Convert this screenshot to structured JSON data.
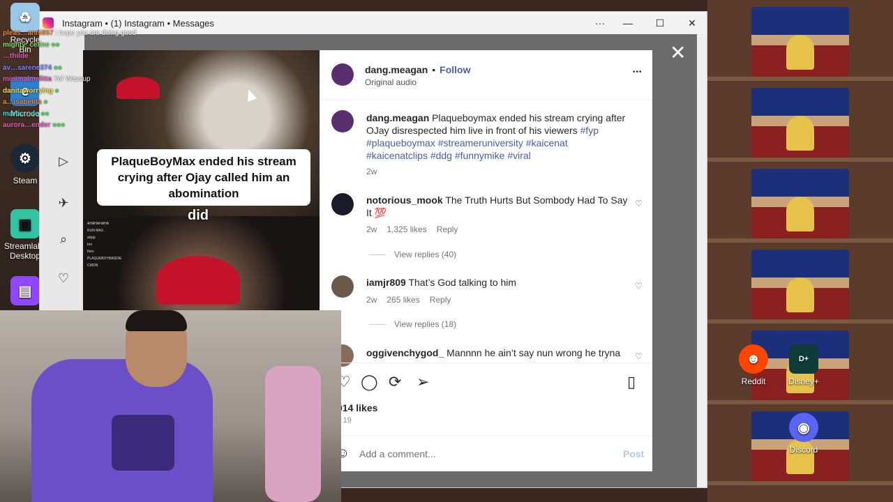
{
  "window": {
    "title": "Instagram • (1) Instagram • Messages",
    "menu_label": "···",
    "minimize": "—",
    "maximize": "☐",
    "close": "✕"
  },
  "desktop_icons": {
    "recycle": "Recycle Bin",
    "steam": "Steam",
    "streamlabs": "Streamlabs Desktop",
    "microsoft": "Microso",
    "reddit": "Reddit",
    "disney": "Disney+",
    "discord": "Discord"
  },
  "chat": [
    {
      "user": "pleas…anni857",
      "msg": "i hope you are doing good",
      "color": "#e88a3a"
    },
    {
      "user": "mighty_celine",
      "msg": "",
      "color": "#7de06a"
    },
    {
      "user": "…thilde",
      "msg": "",
      "color": "#e060b8"
    },
    {
      "user": "av…sarene374",
      "msg": "",
      "color": "#7a86ff"
    },
    {
      "user": "minimalmelitta",
      "msg": "Yo! Wassup",
      "color": "#e060b8"
    },
    {
      "user": "danitaworrying",
      "msg": "",
      "color": "#f0e040"
    },
    {
      "user": "a…isabelita",
      "msg": "",
      "color": "#e88a3a"
    },
    {
      "user": "martic…de",
      "msg": "",
      "color": "#40e0e0"
    },
    {
      "user": "aurora…ender",
      "msg": "",
      "color": "#e060b8"
    }
  ],
  "video": {
    "caption": "PlaqueBoyMax ended his stream crying after Ojay called him an abomination",
    "word": "did",
    "overlay_lines": [
      "AHAHAHAHA",
      "RUN MAX",
      "skipp",
      "bro",
      "fries",
      "PLAQUEBOYBADDIE",
      "CMON"
    ]
  },
  "post": {
    "author": "dang.meagan",
    "follow": "Follow",
    "separator": "•",
    "audio": "Original audio",
    "more": "•••",
    "caption_text": "Plaqueboymax ended his stream crying after OJay disrespected him live in front of his viewers",
    "hashtags_1": "#fyp",
    "hashtags_2": "#plaqueboymax #streameruniversity #kaicenat #kaicenatclips",
    "hashtags_3": "#ddg #funnymike #viral",
    "caption_age": "2w",
    "likes": "914 likes",
    "date": "y 19",
    "add_comment": "Add a comment...",
    "post_button": "Post"
  },
  "comments": [
    {
      "user": "notorious_mook",
      "text": "The Truth Hurts But Sombody Had To Say It 💯",
      "age": "2w",
      "likes": "1,325 likes",
      "reply": "Reply",
      "view_replies": "View replies (40)"
    },
    {
      "user": "iamjr809",
      "text": "That’s God talking to him",
      "age": "2w",
      "likes": "265 likes",
      "reply": "Reply",
      "view_replies": "View replies (18)"
    },
    {
      "user": "oggivenchygod_",
      "text": "Mannnn he ain’t say nun wrong he tryna"
    }
  ],
  "colors": {
    "accent": "#4a5ba8",
    "follow": "#4a5ba8",
    "post": "#b2c7ea"
  }
}
